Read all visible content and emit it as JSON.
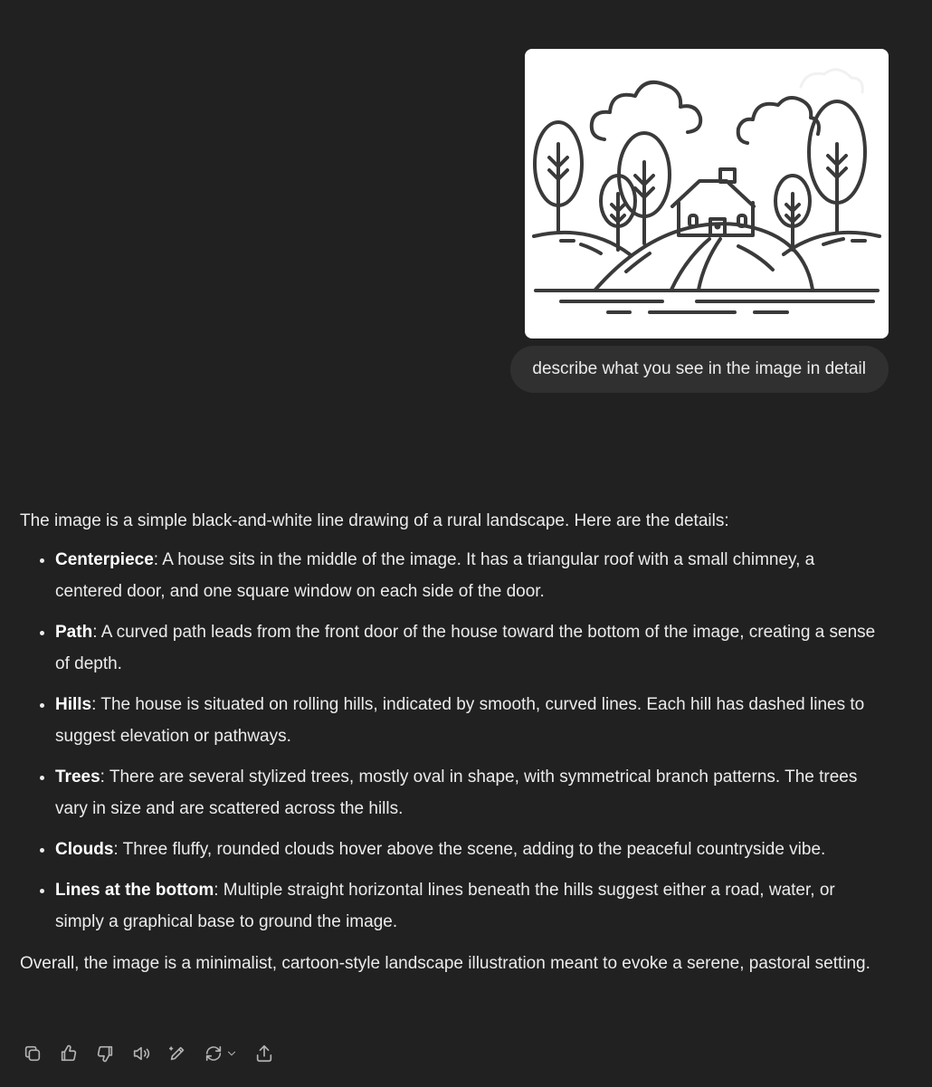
{
  "conversation": {
    "user_message": {
      "text": "describe what you see in the image in detail"
    },
    "assistant_message": {
      "intro": "The image is a simple black-and-white line drawing of a rural landscape. Here are the details:",
      "items": [
        {
          "term": "Centerpiece",
          "text": ": A house sits in the middle of the image. It has a triangular roof with a small chimney, a centered door, and one square window on each side of the door."
        },
        {
          "term": "Path",
          "text": ": A curved path leads from the front door of the house toward the bottom of the image, creating a sense of depth."
        },
        {
          "term": "Hills",
          "text": ": The house is situated on rolling hills, indicated by smooth, curved lines. Each hill has dashed lines to suggest elevation or pathways."
        },
        {
          "term": "Trees",
          "text": ": There are several stylized trees, mostly oval in shape, with symmetrical branch patterns. The trees vary in size and are scattered across the hills."
        },
        {
          "term": "Clouds",
          "text": ": Three fluffy, rounded clouds hover above the scene, adding to the peaceful countryside vibe."
        },
        {
          "term": "Lines at the bottom",
          "text": ": Multiple straight horizontal lines beneath the hills suggest either a road, water, or simply a graphical base to ground the image."
        }
      ],
      "outro": "Overall, the image is a minimalist, cartoon-style landscape illustration meant to evoke a serene, pastoral setting."
    }
  },
  "action_bar": {
    "icons": [
      "copy-icon",
      "thumbs-up-icon",
      "thumbs-down-icon",
      "read-aloud-icon",
      "edit-icon",
      "regenerate-icon",
      "share-icon"
    ]
  },
  "colors": {
    "background": "#212121",
    "user_bubble": "#303030",
    "text": "#ececec",
    "icon": "#b4b4b4",
    "drawing_stroke": "#3a3a3a"
  }
}
